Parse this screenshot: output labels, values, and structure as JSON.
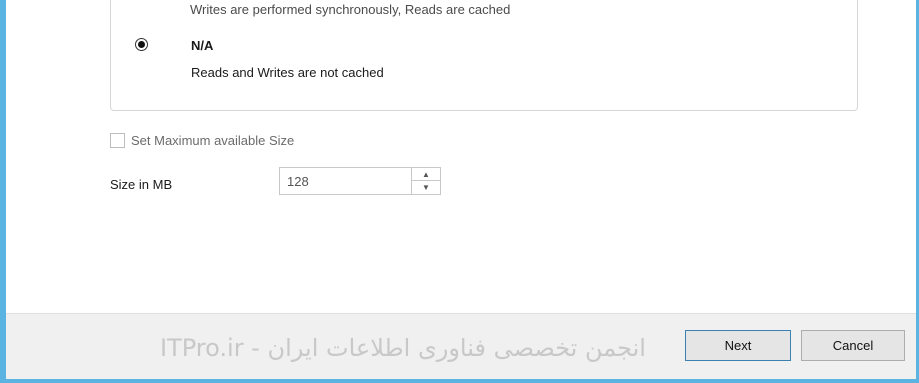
{
  "cached_option_partial": "Writes are performed synchronously, Reads are cached",
  "option_na": {
    "title": "N/A",
    "description": "Reads and Writes are not cached",
    "selected": true
  },
  "max_size_checkbox": {
    "label": "Set Maximum available Size",
    "checked": false
  },
  "size": {
    "label": "Size in MB",
    "value": "128"
  },
  "watermark": "ITPro.ir - انجمن تخصصی فناوری اطلاعات ایران",
  "footer": {
    "next_label": "Next",
    "cancel_label": "Cancel"
  },
  "colors": {
    "accent": "#5ab3e0",
    "footer_bg": "#f0f0f0"
  }
}
